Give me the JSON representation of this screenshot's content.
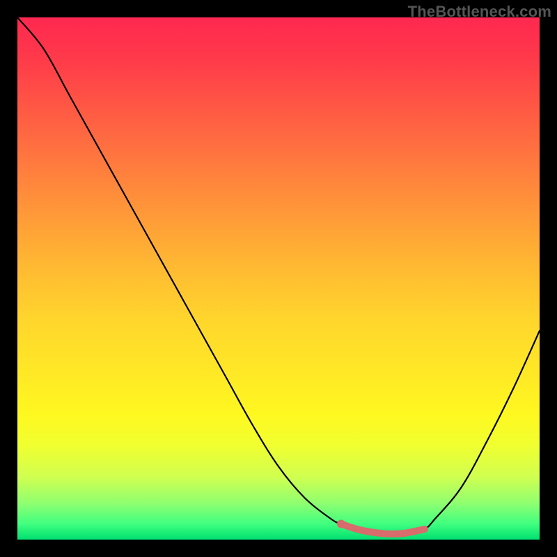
{
  "watermark": "TheBottleneck.com",
  "colors": {
    "curve": "#000000",
    "trough_mark": "#d86b6b",
    "gradient_top": "#ff2850",
    "gradient_bottom": "#00e070",
    "background": "#000000"
  },
  "chart_data": {
    "type": "line",
    "title": "",
    "xlabel": "",
    "ylabel": "",
    "xlim": [
      0,
      100
    ],
    "ylim": [
      0,
      100
    ],
    "x": [
      0,
      5,
      10,
      15,
      20,
      25,
      30,
      35,
      40,
      45,
      50,
      55,
      60,
      62,
      65,
      70,
      75,
      78,
      80,
      85,
      90,
      95,
      100
    ],
    "values": [
      100,
      94,
      85,
      76,
      67,
      58,
      49,
      40,
      31,
      22,
      14,
      8,
      4,
      3,
      2,
      1,
      1,
      2,
      4,
      10,
      19,
      29,
      40
    ],
    "trough": {
      "x_start": 62,
      "x_end": 78,
      "y_start": 3,
      "y_end": 2,
      "points_x": [
        62,
        65,
        68,
        71,
        74,
        78
      ],
      "points_y": [
        3.0,
        2.0,
        1.4,
        1.1,
        1.2,
        2.0
      ]
    },
    "annotations": []
  }
}
